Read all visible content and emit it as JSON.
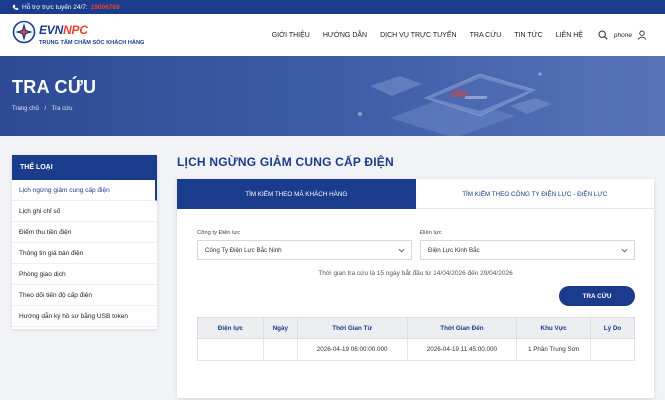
{
  "topbar": {
    "hotline_label": "Hỗ trợ trực tuyến 24/7:",
    "hotline_number": "19006769"
  },
  "logo": {
    "brand_a": "EVN",
    "brand_b": "NPC",
    "subtitle": "TRUNG TÂM CHĂM SÓC KHÁCH HÀNG"
  },
  "nav": {
    "items": [
      "GIỚI THIỆU",
      "HƯỚNG DẪN",
      "DỊCH VỤ TRỰC TUYẾN",
      "TRA CỨU",
      "TIN TỨC",
      "LIÊN HỆ"
    ],
    "phone_text": "phone"
  },
  "banner": {
    "title": "TRA CỨU",
    "breadcrumb": [
      "Trang chủ",
      "/",
      "Tra cứu"
    ]
  },
  "sidebar": {
    "heading": "THỂ LOẠI",
    "items": [
      "Lịch ngừng giảm cung cấp điện",
      "Lịch ghi chỉ số",
      "Điểm thu tiền điện",
      "Thông tin giá bán điện",
      "Phòng giao dịch",
      "Theo dõi tiến độ cấp điện",
      "Hướng dẫn ký hồ sơ bằng USB token"
    ]
  },
  "main": {
    "title": "LỊCH NGỪNG GIẢM CUNG CẤP ĐIỆN",
    "tabs": [
      "TÌM KIẾM THEO MÃ KHÁCH HÀNG",
      "TÌM KIẾM THEO CÔNG TY ĐIỆN LỰC - ĐIỆN LỰC"
    ],
    "company_label": "Công ty Điện lực",
    "company_value": "Công Ty Điện Lực Bắc Ninh",
    "branch_label": "Điện lực",
    "branch_value": "Điện Lực Kinh Bắc",
    "hint": "Thời gian tra cứu là 15 ngày bắt đầu từ 14/04/2026 đến 29/04/2026",
    "search_button": "TRA CỨU",
    "table": {
      "headers": [
        "Điện lực",
        "Ngày",
        "Thời Gian Từ",
        "Thời Gian Đến",
        "Khu Vực",
        "Lý Do"
      ],
      "rows": [
        [
          "",
          "",
          "2026-04-19 06:00:00.000",
          "2026-04-19 11:45:00.000",
          "1 Phần Trung Sơn",
          ""
        ]
      ]
    }
  },
  "colors": {
    "primary": "#1b3b8c",
    "accent": "#e8432e"
  }
}
